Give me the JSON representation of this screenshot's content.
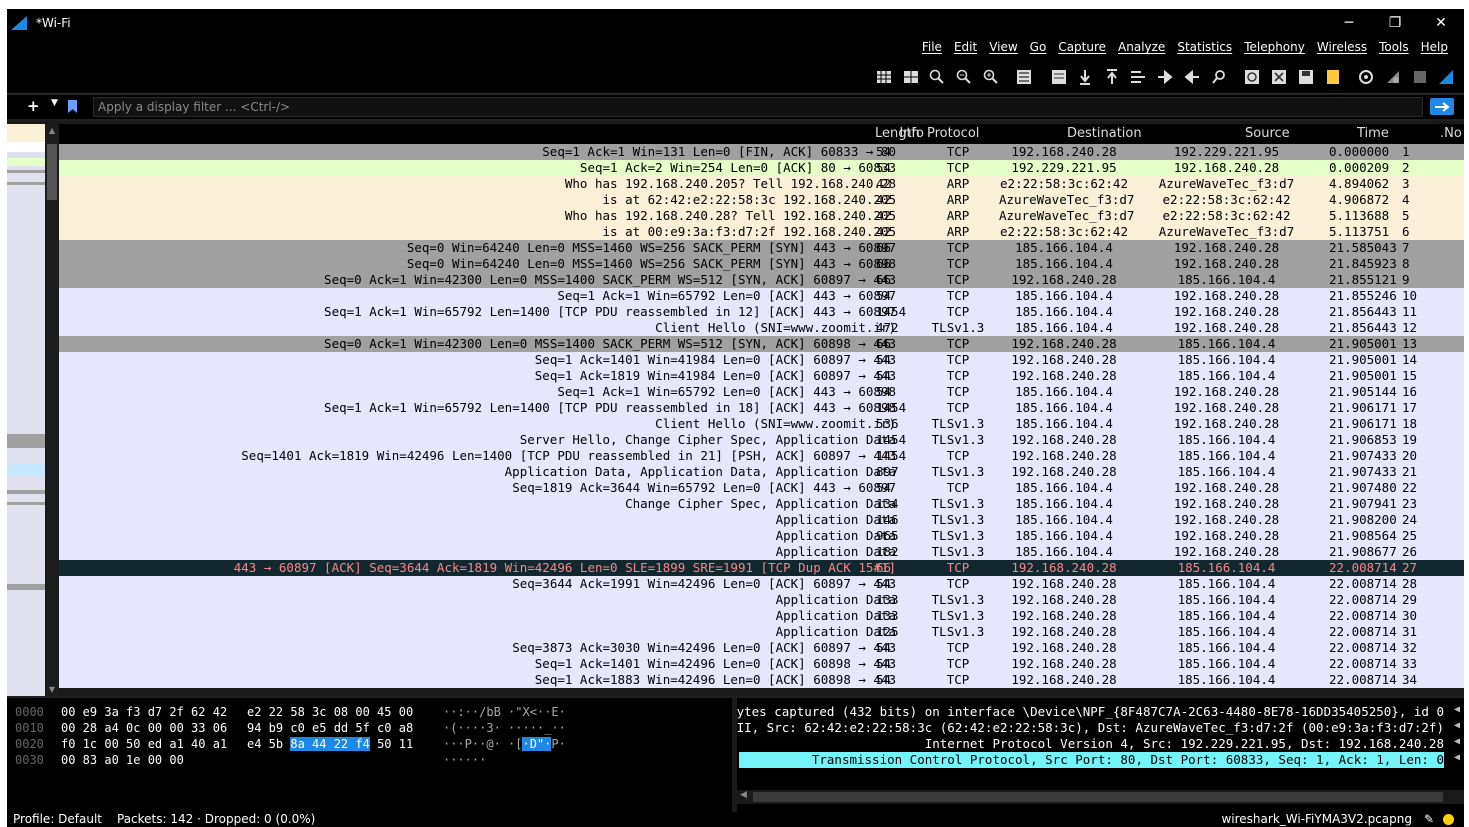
{
  "window": {
    "title": "*Wi-Fi",
    "min": "─",
    "max": "❐",
    "close": "✕"
  },
  "menu": [
    "Help",
    "Tools",
    "Wireless",
    "Telephony",
    "Statistics",
    "Analyze",
    "Capture",
    "Go",
    "View",
    "Edit",
    "File"
  ],
  "toolbar_icons": [
    "resize-columns-icon",
    "colorize-icon",
    "zoom-reset-icon",
    "zoom-out-icon",
    "zoom-in-icon",
    "auto-scroll-icon",
    "colorize-list-icon",
    "go-last-icon",
    "go-first-icon",
    "go-to-packet-icon",
    "go-forward-icon",
    "go-back-icon",
    "find-icon",
    "reload-icon",
    "close-file-icon",
    "save-icon",
    "open-icon",
    "options-icon",
    "restart-icon",
    "stop-icon",
    "start-icon"
  ],
  "filter": {
    "placeholder": "Apply a display filter ... <Ctrl-/>"
  },
  "columns": {
    "info": "Info",
    "length": "Length",
    "protocol": "Protocol",
    "destination": "Destination",
    "source": "Source",
    "time": "Time",
    "no": ".No"
  },
  "packets": [
    {
      "no": "1",
      "time": "0.000000",
      "src": "192.229.221.95",
      "dst": "192.168.240.28",
      "proto": "TCP",
      "len": "54",
      "info": "Seq=1 Ack=1 Win=131 Len=0 [FIN, ACK] 60833 → 80",
      "bg": "#a0a0a0",
      "fg": "#000000"
    },
    {
      "no": "2",
      "time": "0.000209",
      "src": "192.168.240.28",
      "dst": "192.229.221.95",
      "proto": "TCP",
      "len": "54",
      "info": "Seq=1 Ack=2 Win=254 Len=0 [ACK] 80 → 60833",
      "bg": "#e4ffc7",
      "fg": "#000000"
    },
    {
      "no": "3",
      "time": "4.894062",
      "src": "AzureWaveTec_f3:d7",
      "dst": "e2:22:58:3c:62:42",
      "proto": "ARP",
      "len": "42",
      "info": "Who has 192.168.240.205? Tell 192.168.240.28",
      "bg": "#faf0d7",
      "fg": "#000000"
    },
    {
      "no": "4",
      "time": "4.906872",
      "src": "e2:22:58:3c:62:42",
      "dst": "AzureWaveTec_f3:d7",
      "proto": "ARP",
      "len": "42",
      "info": "is at 62:42:e2:22:58:3c 192.168.240.205",
      "bg": "#faf0d7",
      "fg": "#000000"
    },
    {
      "no": "5",
      "time": "5.113688",
      "src": "e2:22:58:3c:62:42",
      "dst": "AzureWaveTec_f3:d7",
      "proto": "ARP",
      "len": "42",
      "info": "Who has 192.168.240.28? Tell 192.168.240.205",
      "bg": "#faf0d7",
      "fg": "#000000"
    },
    {
      "no": "6",
      "time": "5.113751",
      "src": "AzureWaveTec_f3:d7",
      "dst": "e2:22:58:3c:62:42",
      "proto": "ARP",
      "len": "42",
      "info": "is at 00:e9:3a:f3:d7:2f 192.168.240.205",
      "bg": "#faf0d7",
      "fg": "#000000"
    },
    {
      "no": "7",
      "time": "21.585043",
      "src": "192.168.240.28",
      "dst": "185.166.104.4",
      "proto": "TCP",
      "len": "66",
      "info": "Seq=0 Win=64240 Len=0 MSS=1460 WS=256 SACK_PERM [SYN] 443 → 60897",
      "bg": "#a0a0a0",
      "fg": "#000000"
    },
    {
      "no": "8",
      "time": "21.845923",
      "src": "192.168.240.28",
      "dst": "185.166.104.4",
      "proto": "TCP",
      "len": "66",
      "info": "Seq=0 Win=64240 Len=0 MSS=1460 WS=256 SACK_PERM [SYN] 443 → 60898",
      "bg": "#a0a0a0",
      "fg": "#000000"
    },
    {
      "no": "9",
      "time": "21.855121",
      "src": "185.166.104.4",
      "dst": "192.168.240.28",
      "proto": "TCP",
      "len": "66",
      "info": "Seq=0 Ack=1 Win=42300 Len=0 MSS=1400 SACK_PERM WS=512 [SYN, ACK] 60897 → 443",
      "bg": "#a0a0a0",
      "fg": "#000000"
    },
    {
      "no": "10",
      "time": "21.855246",
      "src": "192.168.240.28",
      "dst": "185.166.104.4",
      "proto": "TCP",
      "len": "54",
      "info": "Seq=1 Ack=1 Win=65792 Len=0 [ACK] 443 → 60897",
      "bg": "#e7e6ff",
      "fg": "#000000"
    },
    {
      "no": "11",
      "time": "21.856443",
      "src": "192.168.240.28",
      "dst": "185.166.104.4",
      "proto": "TCP",
      "len": "1454",
      "info": "Seq=1 Ack=1 Win=65792 Len=1400 [TCP PDU reassembled in 12] [ACK] 443 → 60897",
      "bg": "#e7e6ff",
      "fg": "#000000"
    },
    {
      "no": "12",
      "time": "21.856443",
      "src": "192.168.240.28",
      "dst": "185.166.104.4",
      "proto": "TLSv1.3",
      "len": "472",
      "info": "Client Hello (SNI=www.zoomit.ir)",
      "bg": "#e7e6ff",
      "fg": "#000000"
    },
    {
      "no": "13",
      "time": "21.905001",
      "src": "185.166.104.4",
      "dst": "192.168.240.28",
      "proto": "TCP",
      "len": "66",
      "info": "Seq=0 Ack=1 Win=42300 Len=0 MSS=1400 SACK_PERM WS=512 [SYN, ACK] 60898 → 443",
      "bg": "#a0a0a0",
      "fg": "#000000"
    },
    {
      "no": "14",
      "time": "21.905001",
      "src": "185.166.104.4",
      "dst": "192.168.240.28",
      "proto": "TCP",
      "len": "54",
      "info": "Seq=1 Ack=1401 Win=41984 Len=0 [ACK] 60897 → 443",
      "bg": "#e7e6ff",
      "fg": "#000000"
    },
    {
      "no": "15",
      "time": "21.905001",
      "src": "185.166.104.4",
      "dst": "192.168.240.28",
      "proto": "TCP",
      "len": "54",
      "info": "Seq=1 Ack=1819 Win=41984 Len=0 [ACK] 60897 → 443",
      "bg": "#e7e6ff",
      "fg": "#000000"
    },
    {
      "no": "16",
      "time": "21.905144",
      "src": "192.168.240.28",
      "dst": "185.166.104.4",
      "proto": "TCP",
      "len": "54",
      "info": "Seq=1 Ack=1 Win=65792 Len=0 [ACK] 443 → 60898",
      "bg": "#e7e6ff",
      "fg": "#000000"
    },
    {
      "no": "17",
      "time": "21.906171",
      "src": "192.168.240.28",
      "dst": "185.166.104.4",
      "proto": "TCP",
      "len": "1454",
      "info": "Seq=1 Ack=1 Win=65792 Len=1400 [TCP PDU reassembled in 18] [ACK] 443 → 60898",
      "bg": "#e7e6ff",
      "fg": "#000000"
    },
    {
      "no": "18",
      "time": "21.906171",
      "src": "192.168.240.28",
      "dst": "185.166.104.4",
      "proto": "TLSv1.3",
      "len": "536",
      "info": "Client Hello (SNI=www.zoomit.ir)",
      "bg": "#e7e6ff",
      "fg": "#000000"
    },
    {
      "no": "19",
      "time": "21.906853",
      "src": "185.166.104.4",
      "dst": "192.168.240.28",
      "proto": "TLSv1.3",
      "len": "1454",
      "info": "Server Hello, Change Cipher Spec, Application Data",
      "bg": "#e7e6ff",
      "fg": "#000000"
    },
    {
      "no": "20",
      "time": "21.907433",
      "src": "185.166.104.4",
      "dst": "192.168.240.28",
      "proto": "TCP",
      "len": "1454",
      "info": "Seq=1401 Ack=1819 Win=42496 Len=1400 [TCP PDU reassembled in 21] [PSH, ACK] 60897 → 443",
      "bg": "#e7e6ff",
      "fg": "#000000"
    },
    {
      "no": "21",
      "time": "21.907433",
      "src": "185.166.104.4",
      "dst": "192.168.240.28",
      "proto": "TLSv1.3",
      "len": "897",
      "info": "Application Data, Application Data, Application Data",
      "bg": "#e7e6ff",
      "fg": "#000000"
    },
    {
      "no": "22",
      "time": "21.907480",
      "src": "192.168.240.28",
      "dst": "185.166.104.4",
      "proto": "TCP",
      "len": "54",
      "info": "Seq=1819 Ack=3644 Win=65792 Len=0 [ACK] 443 → 60897",
      "bg": "#e7e6ff",
      "fg": "#000000"
    },
    {
      "no": "23",
      "time": "21.907941",
      "src": "192.168.240.28",
      "dst": "185.166.104.4",
      "proto": "TLSv1.3",
      "len": "134",
      "info": "Change Cipher Spec, Application Data",
      "bg": "#e7e6ff",
      "fg": "#000000"
    },
    {
      "no": "24",
      "time": "21.908200",
      "src": "192.168.240.28",
      "dst": "185.166.104.4",
      "proto": "TLSv1.3",
      "len": "146",
      "info": "Application Data",
      "bg": "#e7e6ff",
      "fg": "#000000"
    },
    {
      "no": "25",
      "time": "21.908564",
      "src": "192.168.240.28",
      "dst": "185.166.104.4",
      "proto": "TLSv1.3",
      "len": "965",
      "info": "Application Data",
      "bg": "#e7e6ff",
      "fg": "#000000"
    },
    {
      "no": "26",
      "time": "21.908677",
      "src": "192.168.240.28",
      "dst": "185.166.104.4",
      "proto": "TLSv1.3",
      "len": "182",
      "info": "Application Data",
      "bg": "#e7e6ff",
      "fg": "#000000"
    },
    {
      "no": "27",
      "time": "22.008714",
      "src": "185.166.104.4",
      "dst": "192.168.240.28",
      "proto": "TCP",
      "len": "66",
      "info": "443 → 60897 [ACK] Seq=3644 Ack=1819 Win=42496 Len=0 SLE=1899 SRE=1991 [TCP Dup ACK 15#1]",
      "bg": "#12272e",
      "fg": "#f78787"
    },
    {
      "no": "28",
      "time": "22.008714",
      "src": "185.166.104.4",
      "dst": "192.168.240.28",
      "proto": "TCP",
      "len": "54",
      "info": "Seq=3644 Ack=1991 Win=42496 Len=0 [ACK] 60897 → 443",
      "bg": "#e7e6ff",
      "fg": "#000000"
    },
    {
      "no": "29",
      "time": "22.008714",
      "src": "185.166.104.4",
      "dst": "192.168.240.28",
      "proto": "TLSv1.3",
      "len": "133",
      "info": "Application Data",
      "bg": "#e7e6ff",
      "fg": "#000000"
    },
    {
      "no": "30",
      "time": "22.008714",
      "src": "185.166.104.4",
      "dst": "192.168.240.28",
      "proto": "TLSv1.3",
      "len": "133",
      "info": "Application Data",
      "bg": "#e7e6ff",
      "fg": "#000000"
    },
    {
      "no": "31",
      "time": "22.008714",
      "src": "185.166.104.4",
      "dst": "192.168.240.28",
      "proto": "TLSv1.3",
      "len": "125",
      "info": "Application Data",
      "bg": "#e7e6ff",
      "fg": "#000000"
    },
    {
      "no": "32",
      "time": "22.008714",
      "src": "185.166.104.4",
      "dst": "192.168.240.28",
      "proto": "TCP",
      "len": "54",
      "info": "Seq=3873 Ack=3030 Win=42496 Len=0 [ACK] 60897 → 443",
      "bg": "#e7e6ff",
      "fg": "#000000"
    },
    {
      "no": "33",
      "time": "22.008714",
      "src": "185.166.104.4",
      "dst": "192.168.240.28",
      "proto": "TCP",
      "len": "54",
      "info": "Seq=1 Ack=1401 Win=42496 Len=0 [ACK] 60898 → 443",
      "bg": "#e7e6ff",
      "fg": "#000000"
    },
    {
      "no": "34",
      "time": "22.008714",
      "src": "185.166.104.4",
      "dst": "192.168.240.28",
      "proto": "TCP",
      "len": "54",
      "info": "Seq=1 Ack=1883 Win=42496 Len=0 [ACK] 60898 → 443",
      "bg": "#e7e6ff",
      "fg": "#000000"
    }
  ],
  "hex_lines": [
    {
      "offset": "0000",
      "bytes_a": "00 e9 3a f3 d7 2f 62 42",
      "bytes_b": "e2 22 58 3c 08 00 45 00",
      "ascii": "··:··/bB ·\"X<··E·"
    },
    {
      "offset": "0010",
      "bytes_a": "00 28 a4 0c 00 00 33 06",
      "bytes_b": "94 b9 c0 e5 dd 5f c0 a8",
      "ascii": "·(····3· ·····_··"
    },
    {
      "offset": "0020",
      "bytes_a": "f0 1c 00 50 ed a1 40 a1",
      "bytes_b": "e4 5b ",
      "hl": "8a 44 22 f4",
      "bytes_c": " 50 11",
      "ascii_a": "···P··@· ·[",
      "ascii_hl": "·D\"·",
      "ascii_b": "P·"
    },
    {
      "offset": "0030",
      "bytes_a": "00 83 a0 1e 00 00",
      "bytes_b": "",
      "ascii": "······"
    }
  ],
  "details": [
    "ytes captured (432 bits) on interface \\Device\\NPF_{8F487C7A-2C63-4480-8E78-16DD35405250}, id 0",
    "II, Src: 62:42:e2:22:58:3c (62:42:e2:22:58:3c), Dst: AzureWaveTec_f3:d7:2f (00:e9:3a:f3:d7:2f)",
    "Internet Protocol Version 4, Src: 192.229.221.95, Dst: 192.168.240.28",
    "Transmission Control Protocol, Src Port: 80, Dst Port: 60833, Seq: 1, Ack: 1, Len: 0"
  ],
  "status": {
    "profile": "Profile: Default",
    "packets": "Packets: 142 · Dropped: 0 (0.0%)",
    "file": "wireshark_Wi-FiYMA3V2.pcapng"
  }
}
